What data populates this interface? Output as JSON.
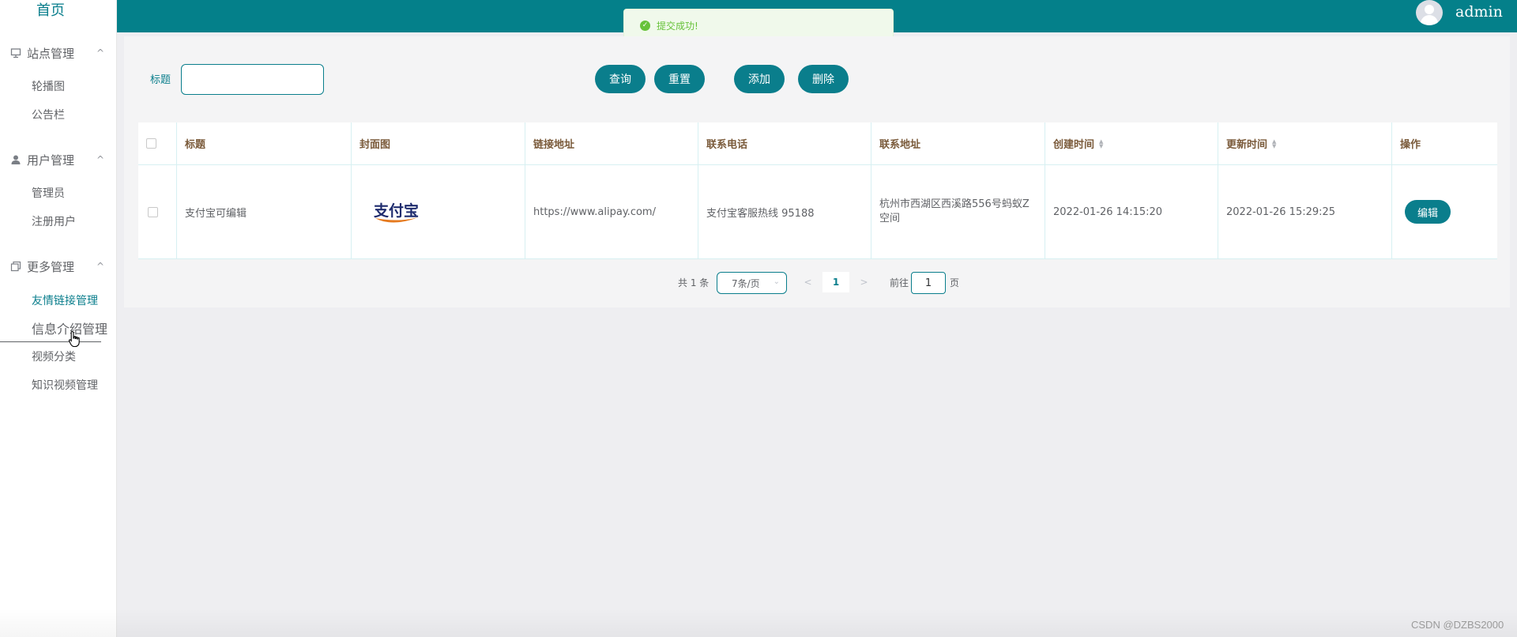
{
  "sidebar": {
    "home": "首页",
    "groups": [
      {
        "title": "站点管理",
        "items": [
          "轮播图",
          "公告栏"
        ]
      },
      {
        "title": "用户管理",
        "items": [
          "管理员",
          "注册用户"
        ]
      },
      {
        "title": "更多管理",
        "items": [
          "友情链接管理",
          "信息介绍管理",
          "视频分类",
          "知识视频管理"
        ]
      }
    ],
    "chevron": "^"
  },
  "header": {
    "username": "admin"
  },
  "toast": {
    "message": "提交成功!",
    "check": "✓"
  },
  "search": {
    "label": "标题",
    "value": ""
  },
  "buttons": {
    "query": "查询",
    "reset": "重置",
    "add": "添加",
    "delete": "删除"
  },
  "table": {
    "columns": [
      "标题",
      "封面图",
      "链接地址",
      "联系电话",
      "联系地址",
      "创建时间",
      "更新时间",
      "操作"
    ],
    "rows": [
      {
        "title": "支付宝可编辑",
        "cover_logo_text": "支付宝",
        "link": "https://www.alipay.com/",
        "phone": "支付宝客服热线 95188",
        "address": "杭州市西湖区西溪路556号蚂蚁Z空间",
        "created": "2022-01-26 14:15:20",
        "updated": "2022-01-26 15:29:25",
        "action": "编辑"
      }
    ]
  },
  "pagination": {
    "total": "共 1 条",
    "page_size": "7条/页",
    "current_page": "1",
    "goto_label": "前往",
    "goto_value": "1",
    "goto_suffix": "页",
    "prev": "<",
    "next": ">",
    "dropdown": "⌄"
  },
  "watermark": "CSDN @DZBS2000",
  "colors": {
    "primary": "#0a7e8c",
    "header": "#04808a",
    "success": "#67c23a"
  },
  "icons": [
    "monitor-icon",
    "user-icon",
    "copy-icon",
    "check-circle-icon",
    "sort-icon",
    "hand-cursor-icon"
  ]
}
